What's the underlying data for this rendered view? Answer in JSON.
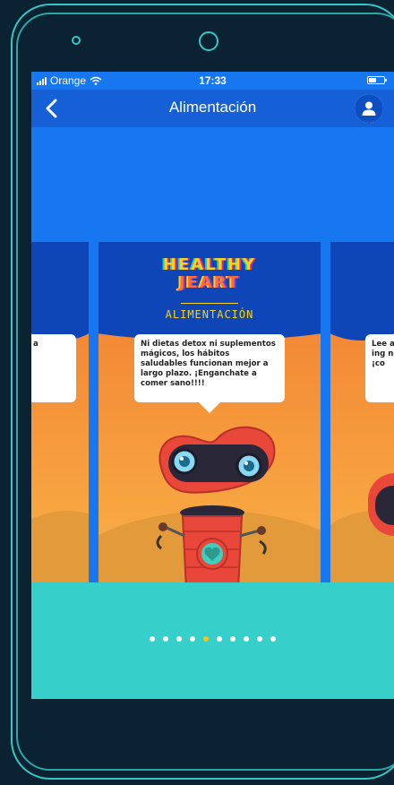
{
  "status_bar": {
    "carrier": "Orange",
    "time": "17:33"
  },
  "nav": {
    "title": "Alimentación"
  },
  "cards": {
    "center": {
      "logo_line1": "HEALTHY",
      "logo_line2": "JEART",
      "section": "ALIMENTACIÓN",
      "bubble_text": "Ni dietas detox ni suplementos mágicos, los hábitos saludables funcionan mejor a largo plazo. ¡Enganchate a comer sano!!!!"
    },
    "left": {
      "bubble_text": "a"
    },
    "right": {
      "bubble_text": "Lee ali ing no ¡co"
    }
  },
  "pagination": {
    "count": 10,
    "active_index": 4
  },
  "colors": {
    "accent_teal": "#36cfc9",
    "nav_blue": "#1560d6",
    "active_dot": "#f5c518"
  }
}
